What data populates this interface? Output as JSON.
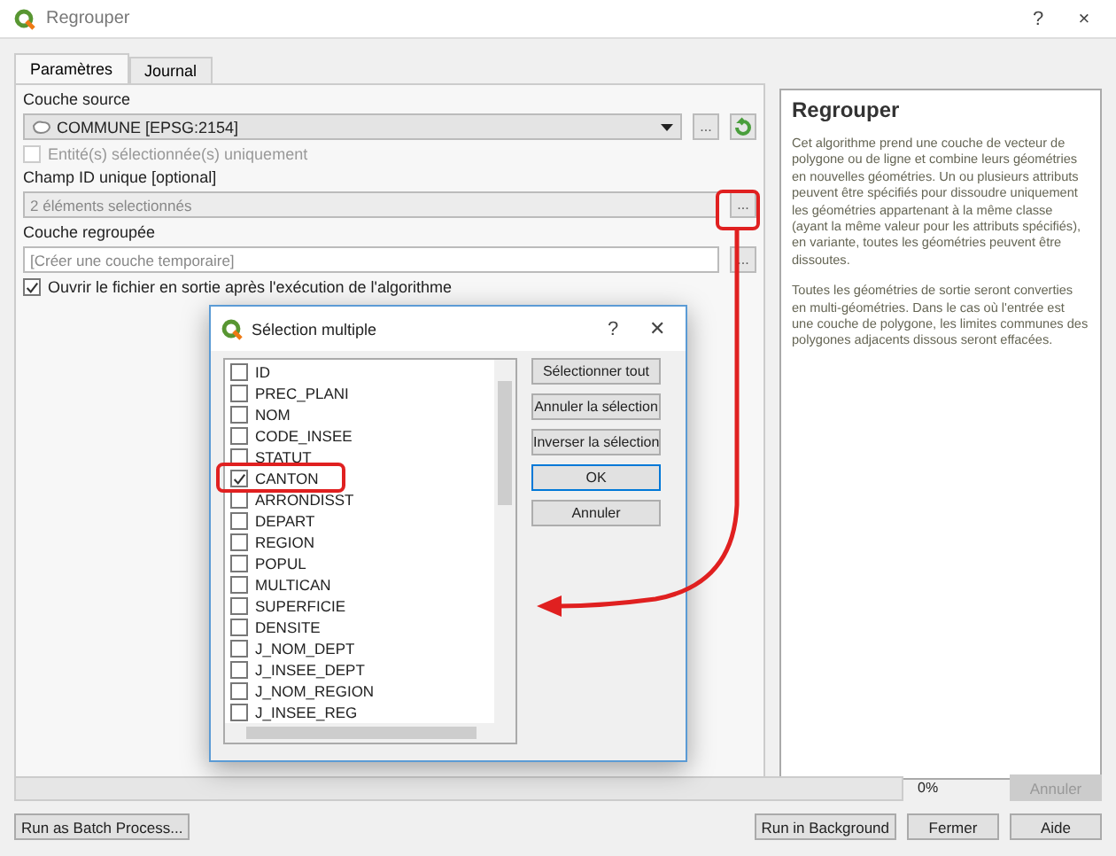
{
  "window": {
    "title": "Regrouper",
    "help": "?",
    "close": "×"
  },
  "tabs": [
    {
      "label": "Paramètres",
      "selected": true
    },
    {
      "label": "Journal",
      "selected": false
    }
  ],
  "form": {
    "source_label": "Couche source",
    "source_value": "COMMUNE [EPSG:2154]",
    "source_browse": "...",
    "selected_only": {
      "label": "Entité(s) sélectionnée(s) uniquement",
      "checked": false,
      "disabled": true
    },
    "id_label": "Champ ID unique [optional]",
    "id_value": "2 éléments selectionnés",
    "id_browse": "...",
    "output_label": "Couche regroupée",
    "output_placeholder": "[Créer une couche temporaire]",
    "output_browse": "...",
    "open_after": {
      "label": "Ouvrir le fichier en sortie après l'exécution de l'algorithme",
      "checked": true
    }
  },
  "help": {
    "title": "Regrouper",
    "paragraphs": [
      "Cet algorithme prend une couche de vecteur de polygone ou de ligne et combine leurs géométries en nouvelles géométries. Un ou plusieurs attributs peuvent être spécifiés pour dissoudre uniquement les géométries appartenant à la même classe (ayant la même valeur pour les attributs spécifiés), en variante, toutes les géométries peuvent être dissoutes.",
      "Toutes les géométries de sortie seront converties en multi-géométries. Dans le cas où l'entrée est une couche de polygone, les limites communes des polygones adjacents dissous seront effacées."
    ]
  },
  "dialog": {
    "title": "Sélection multiple",
    "help": "?",
    "close": "✕",
    "items": [
      {
        "label": "ID",
        "checked": false
      },
      {
        "label": "PREC_PLANI",
        "checked": false
      },
      {
        "label": "NOM",
        "checked": false
      },
      {
        "label": "CODE_INSEE",
        "checked": false
      },
      {
        "label": "STATUT",
        "checked": false
      },
      {
        "label": "CANTON",
        "checked": true
      },
      {
        "label": "ARRONDISST",
        "checked": false
      },
      {
        "label": "DEPART",
        "checked": false
      },
      {
        "label": "REGION",
        "checked": false
      },
      {
        "label": "POPUL",
        "checked": false
      },
      {
        "label": "MULTICAN",
        "checked": false
      },
      {
        "label": "SUPERFICIE",
        "checked": false
      },
      {
        "label": "DENSITE",
        "checked": false
      },
      {
        "label": "J_NOM_DEPT",
        "checked": false
      },
      {
        "label": "J_INSEE_DEPT",
        "checked": false
      },
      {
        "label": "J_NOM_REGION",
        "checked": false
      },
      {
        "label": "J_INSEE_REG",
        "checked": false
      }
    ],
    "buttons": [
      {
        "label": "Sélectionner tout",
        "default": false
      },
      {
        "label": "Annuler la sélection",
        "default": false
      },
      {
        "label": "Inverser la sélection",
        "default": false
      },
      {
        "label": "OK",
        "default": true
      },
      {
        "label": "Annuler",
        "default": false
      }
    ]
  },
  "progress": {
    "level": 0,
    "reading": "0%",
    "cancel": {
      "label": "Annuler",
      "disabled": true
    }
  },
  "buttons": [
    {
      "label": "Run as Batch Process..."
    },
    {
      "label": "Run in Background"
    },
    {
      "label": "Fermer"
    },
    {
      "label": "Aide"
    }
  ]
}
